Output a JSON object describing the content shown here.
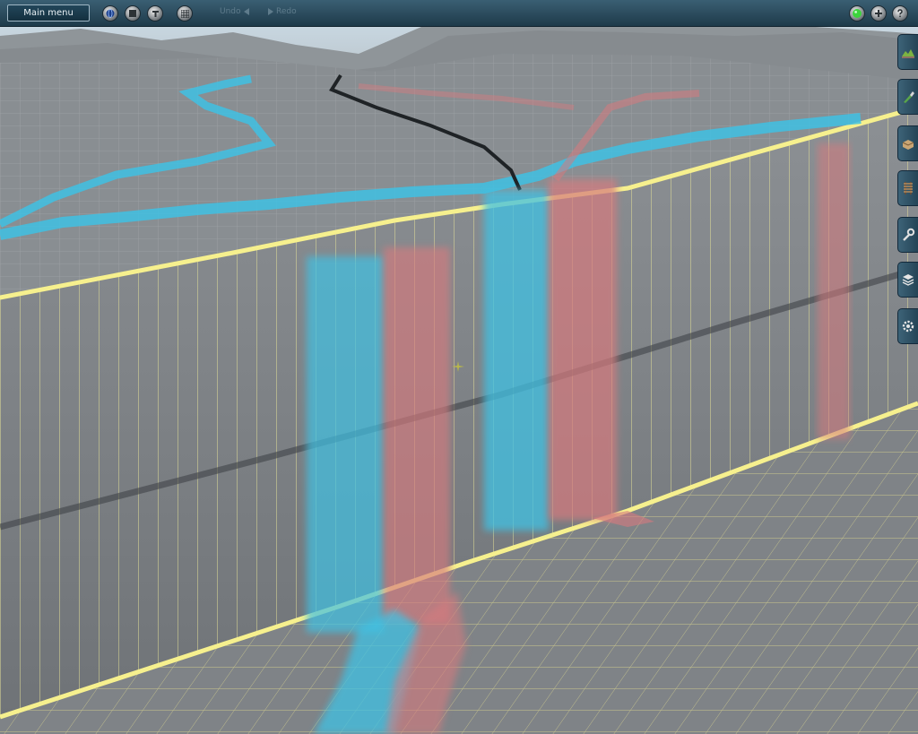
{
  "toolbar": {
    "main_menu_label": "Main menu",
    "undo_label": "Undo",
    "redo_label": "Redo"
  },
  "icons": {
    "left_buttons": [
      "globe-icon",
      "stop-icon",
      "tool-options-icon",
      "grid-icon"
    ],
    "right_buttons": [
      "status-light-icon",
      "add-icon",
      "help-icon"
    ],
    "side_tabs": [
      "terrain-tool-icon",
      "paint-tool-icon",
      "objects-tool-icon",
      "track-tool-icon",
      "wrench-tool-icon",
      "layers-tool-icon",
      "settings-tool-icon"
    ]
  },
  "colors": {
    "water_overlay": "#3fc1e3",
    "height_overlay": "#d67a7e",
    "grid_lines": "#f0ec9a",
    "toolbar": "#2b4e61",
    "status_light": "#3cd43c"
  }
}
